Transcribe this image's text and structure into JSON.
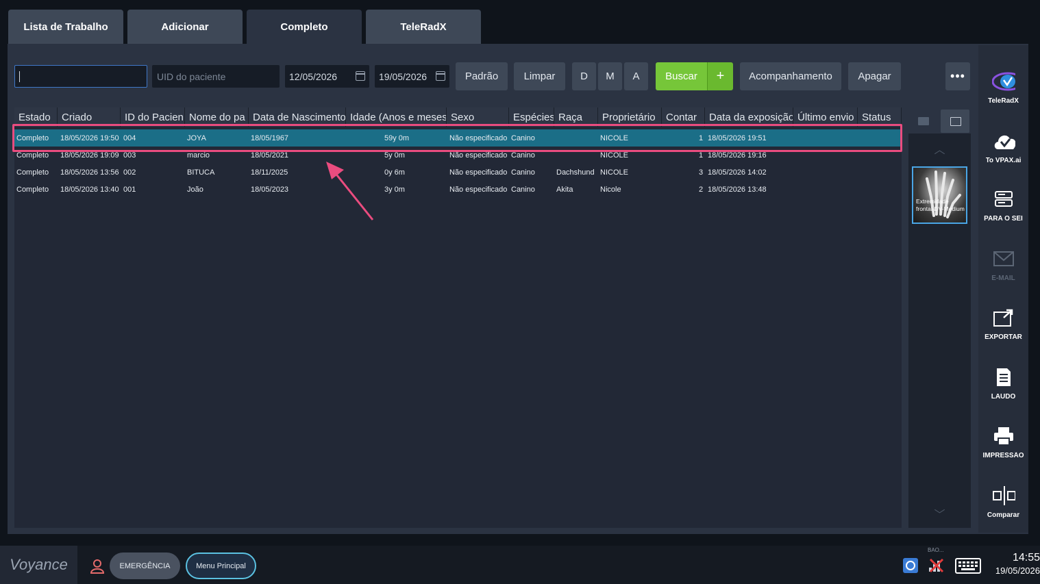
{
  "tabs": [
    {
      "label": "Lista de Trabalho"
    },
    {
      "label": "Adicionar"
    },
    {
      "label": "Completo"
    },
    {
      "label": "TeleRadX"
    }
  ],
  "toolbar": {
    "search_value": "",
    "uid_placeholder": "UID do paciente",
    "date_from": "12/05/2026",
    "date_to": "19/05/2026",
    "padrao": "Padrão",
    "limpar": "Limpar",
    "d": "D",
    "m": "M",
    "a": "A",
    "buscar": "Buscar",
    "plus": "+",
    "acompanhamento": "Acompanhamento",
    "apagar": "Apagar",
    "more": "•••"
  },
  "table": {
    "columns": [
      "Estado",
      "Criado",
      "ID do Pacien",
      "Nome do pa",
      "Data de Nascimento",
      "Idade (Anos e meses)",
      "Sexo",
      "Espécies",
      "Raça",
      "Proprietário",
      "Contar",
      "Data da exposição",
      "Último envio",
      "Status"
    ],
    "rows": [
      [
        "Completo",
        "18/05/2026 19:50",
        "004",
        "JOYA",
        "18/05/1967",
        "59y 0m",
        "Não especificado",
        "Canino",
        "",
        "NICOLE",
        "1",
        "18/05/2026 19:51",
        "",
        ""
      ],
      [
        "Completo",
        "18/05/2026 19:09",
        "003",
        "marcio",
        "18/05/2021",
        "5y 0m",
        "Não especificado",
        "Canino",
        "",
        "NICOLE",
        "1",
        "18/05/2026 19:16",
        "",
        ""
      ],
      [
        "Completo",
        "18/05/2026 13:56",
        "002",
        "BITUCA",
        "18/11/2025",
        "0y 6m",
        "Não especificado",
        "Canino",
        "Dachshund",
        "NICOLE",
        "3",
        "18/05/2026 14:02",
        "",
        ""
      ],
      [
        "Completo",
        "18/05/2026 13:40",
        "001",
        "João",
        "18/05/2023",
        "3y 0m",
        "Não especificado",
        "Canino",
        "Akita",
        "Nicole",
        "2",
        "18/05/2026 13:48",
        "",
        ""
      ]
    ]
  },
  "thumbnail": {
    "label": "Extremidade frontal-DV-Medium"
  },
  "sidebar": {
    "items": [
      {
        "label": "TeleRadX",
        "icon": "eye-icon"
      },
      {
        "label": "To VPAX.ai",
        "icon": "cloud-check-icon"
      },
      {
        "label": "PARA O SEI",
        "icon": "server-icon"
      },
      {
        "label": "E-MAIL",
        "icon": "email-icon"
      },
      {
        "label": "EXPORTAR",
        "icon": "export-icon"
      },
      {
        "label": "LAUDO",
        "icon": "document-icon"
      },
      {
        "label": "IMPRESSÃO",
        "icon": "printer-icon"
      },
      {
        "label": "Comparar",
        "icon": "compare-icon"
      }
    ]
  },
  "bottom": {
    "brand": "Voyance",
    "emergency": "EMERGÊNCIA",
    "main_menu": "Menu Principal",
    "bao": "BAO...",
    "time": "14:55",
    "date": "19/05/2026"
  },
  "colors": {
    "accent_green": "#76c639",
    "selected_row": "#1b6e87",
    "highlight": "#ea4c7f",
    "eye_purple": "#8a52e0"
  }
}
